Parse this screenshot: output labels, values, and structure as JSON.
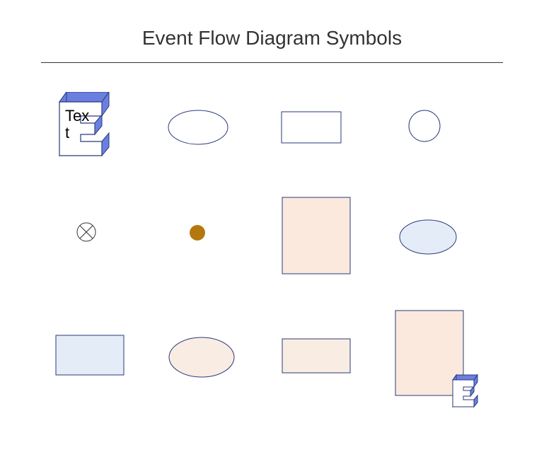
{
  "title": "Event Flow Diagram Symbols",
  "shapes": {
    "extrudedE": {
      "label": "Text"
    }
  },
  "colors": {
    "blueStroke": "#2a3a7a",
    "blueSide": "#6a7fe0",
    "lightBlueFill": "#e4ecf8",
    "peachFill": "#fbe9de",
    "peachFill2": "#f9ece2",
    "orangeDot": "#b5780f",
    "darkStroke": "#333"
  }
}
